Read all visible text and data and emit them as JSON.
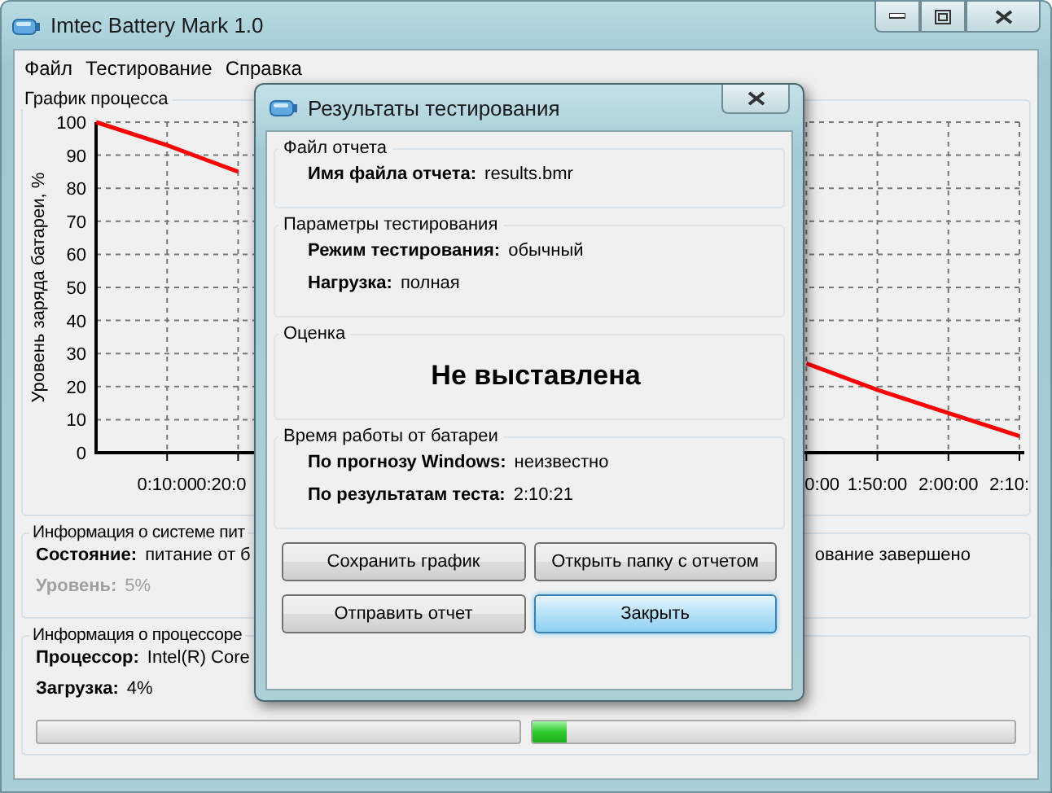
{
  "window": {
    "title": "Imtec Battery Mark 1.0"
  },
  "menu": [
    "Файл",
    "Тестирование",
    "Справка"
  ],
  "chart_panel": {
    "title": "График процесса",
    "chart_data": {
      "type": "line",
      "ylabel": "Уровень заряда батареи, %",
      "x": [
        0,
        600,
        1200,
        6000,
        6600,
        7200,
        7800
      ],
      "xlim": [
        0,
        7800
      ],
      "ylim": [
        0,
        100
      ],
      "yticks": [
        0,
        10,
        20,
        30,
        40,
        50,
        60,
        70,
        80,
        90,
        100
      ],
      "xticks": [
        {
          "value": 600,
          "label": "0:10:00"
        },
        {
          "value": 6600,
          "label": "1:50:00"
        },
        {
          "value": 7200,
          "label": "2:00:00"
        }
      ],
      "grid": true,
      "series": [
        {
          "color": "#ff0000",
          "values": [
            100,
            93,
            85,
            27,
            19,
            12,
            5
          ]
        }
      ]
    },
    "clipped_tick_labels": [
      "0:20:0",
      "0:00",
      "2:10:"
    ]
  },
  "power_panel": {
    "title": "Информация о системе пит",
    "state_label": "Состояние:",
    "state_value": "питание от б",
    "state_tail": "ование завершено",
    "level_label": "Уровень:",
    "level_value": "5%",
    "level_disabled": true
  },
  "cpu_panel": {
    "title": "Информация о процессоре",
    "processor_label": "Процессор:",
    "processor_value": "Intel(R) Core",
    "load_label": "Загрузка:",
    "load_value": "4%",
    "cores": [
      {
        "level": 0.07
      }
    ]
  },
  "dialog": {
    "title": "Результаты тестирования",
    "sections": [
      {
        "title": "Файл отчета",
        "kind": "fields",
        "rows": [
          {
            "label": "Имя файла отчета:",
            "value": "results.bmr"
          }
        ]
      },
      {
        "title": "Параметры тестирования",
        "kind": "fields",
        "rows": [
          {
            "label": "Режим тестирования:",
            "value": "обычный"
          },
          {
            "label": "Нагрузка:",
            "value": "полная"
          }
        ]
      },
      {
        "title": "Оценка",
        "kind": "score",
        "score": "Не выставлена"
      },
      {
        "title": "Время работы от батареи",
        "kind": "fields",
        "rows": [
          {
            "label": "По прогнозу Windows:",
            "value": "неизвестно"
          },
          {
            "label": "По результатам теста:",
            "value": "2:10:21"
          }
        ]
      }
    ],
    "buttons": [
      {
        "label": "Сохранить график",
        "default": false
      },
      {
        "label": "Открыть папку с отчетом",
        "default": false
      },
      {
        "label": "Отправить отчет",
        "default": false
      },
      {
        "label": "Закрыть",
        "default": true
      }
    ]
  }
}
